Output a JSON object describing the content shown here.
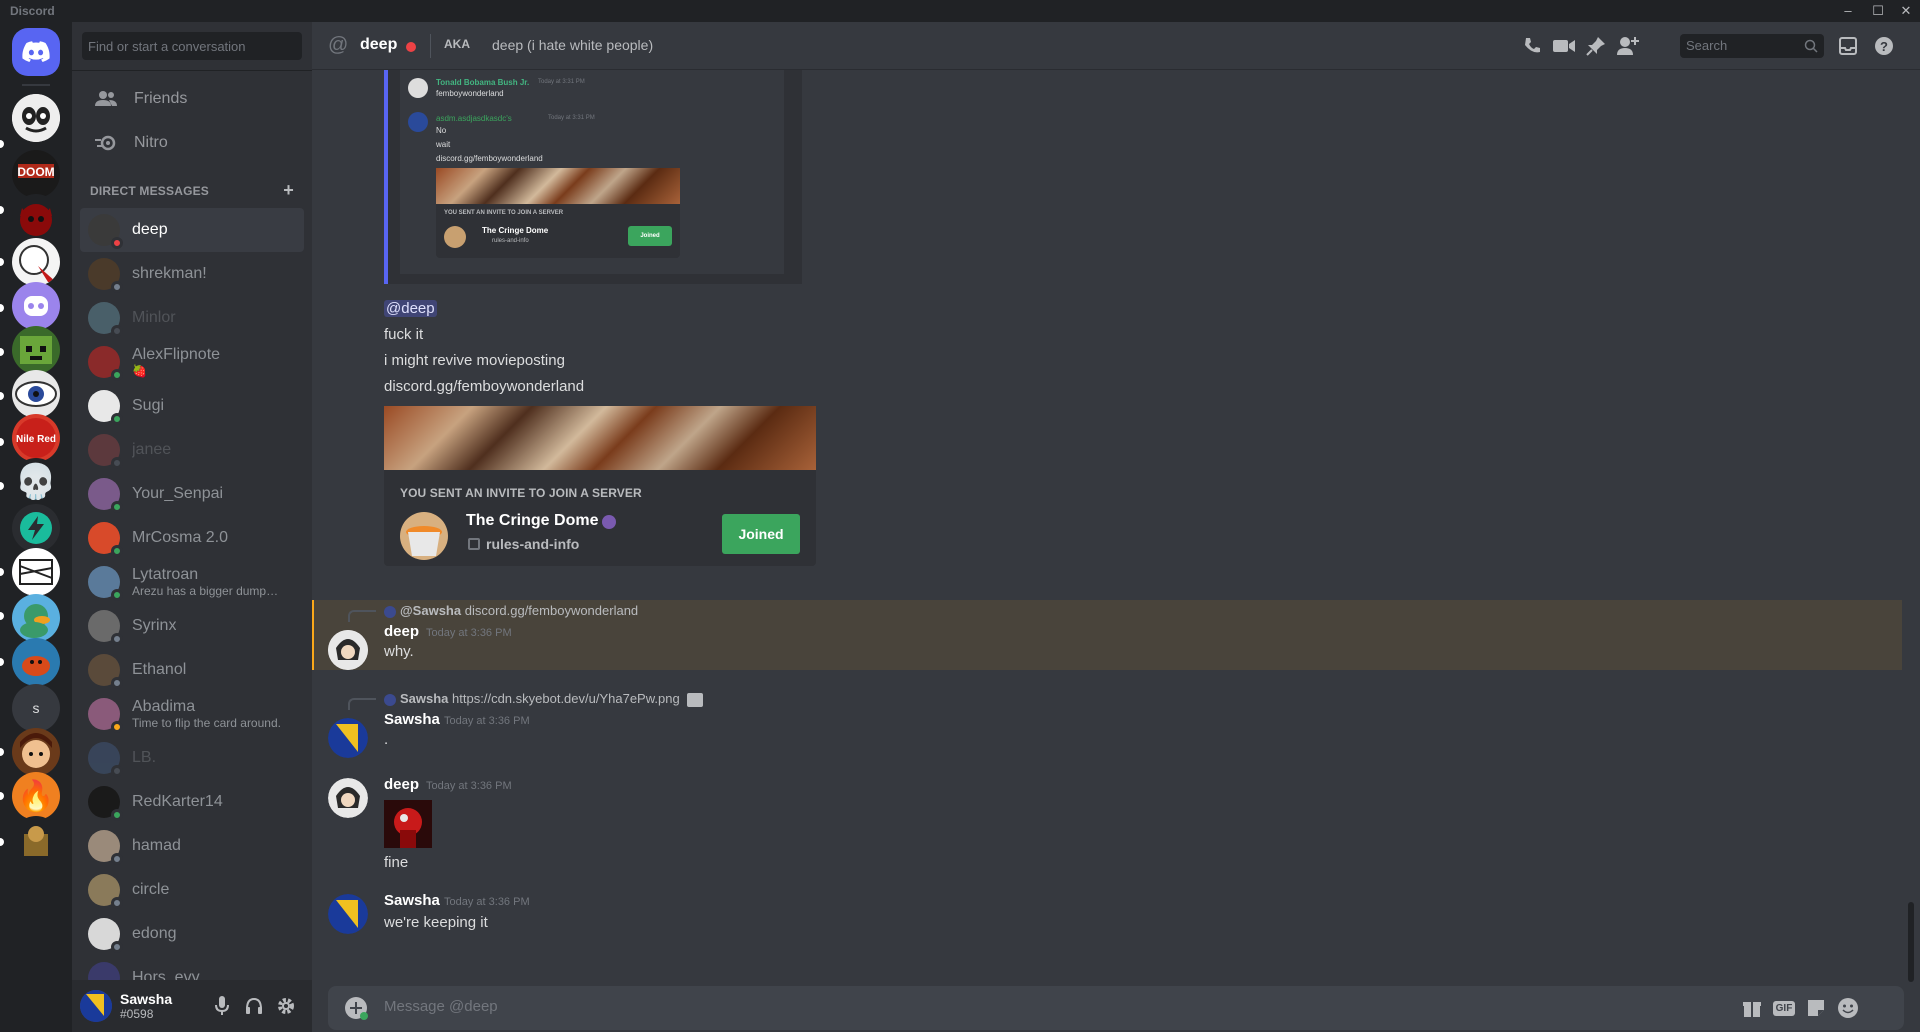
{
  "window": {
    "app_name": "Discord",
    "minimize": "–",
    "maximize": "☐",
    "close": "✕"
  },
  "sidebar": {
    "search_placeholder": "Find or start a conversation",
    "friends_label": "Friends",
    "nitro_label": "Nitro",
    "dm_header": "DIRECT MESSAGES",
    "dm_add": "+",
    "dms": [
      {
        "name": "deep",
        "sub": "",
        "status_color": "#ed4245",
        "avatar_color": "#3a3a3a",
        "active": true,
        "offline": false
      },
      {
        "name": "shrekman!",
        "sub": "",
        "status_color": "#747f8d",
        "avatar_color": "#4a3a2a",
        "active": false,
        "offline": false
      },
      {
        "name": "Minlor",
        "sub": "",
        "status_color": "#747f8d",
        "avatar_color": "#7ab4c9",
        "active": false,
        "offline": true
      },
      {
        "name": "AlexFlipnote",
        "sub": "🍓",
        "status_color": "#3ba55d",
        "avatar_color": "#8a2a2a",
        "active": false,
        "offline": false
      },
      {
        "name": "Sugi",
        "sub": "",
        "status_color": "#3ba55d",
        "avatar_color": "#e8e8e8",
        "active": false,
        "offline": false
      },
      {
        "name": "janee",
        "sub": "",
        "status_color": "#747f8d",
        "avatar_color": "#b04a4a",
        "active": false,
        "offline": true
      },
      {
        "name": "Your_Senpai",
        "sub": "",
        "status_color": "#3ba55d",
        "avatar_color": "#7a5a8a",
        "active": false,
        "offline": false
      },
      {
        "name": "MrCosma 2.0",
        "sub": "",
        "status_color": "#3ba55d",
        "avatar_color": "#d84a2a",
        "active": false,
        "offline": false
      },
      {
        "name": "Lytatroan",
        "sub": "Arezu has a bigger dumpy ...",
        "status_color": "#3ba55d",
        "avatar_color": "#5a7a9a",
        "active": false,
        "offline": false
      },
      {
        "name": "Syrinx",
        "sub": "",
        "status_color": "#747f8d",
        "avatar_color": "#6a6a6a",
        "active": false,
        "offline": false
      },
      {
        "name": "Ethanol",
        "sub": "",
        "status_color": "#747f8d",
        "avatar_color": "#5a4a3a",
        "active": false,
        "offline": false
      },
      {
        "name": "Abadima",
        "sub": "Time to flip the card around.",
        "status_color": "#faa81a",
        "avatar_color": "#8a5a7a",
        "active": false,
        "offline": false
      },
      {
        "name": "LB.",
        "sub": "",
        "status_color": "#747f8d",
        "avatar_color": "#4a6a9a",
        "active": false,
        "offline": true
      },
      {
        "name": "RedKarter14",
        "sub": "",
        "status_color": "#3ba55d",
        "avatar_color": "#1a1a1a",
        "active": false,
        "offline": false
      },
      {
        "name": "hamad",
        "sub": "",
        "status_color": "#747f8d",
        "avatar_color": "#9a8a7a",
        "active": false,
        "offline": false
      },
      {
        "name": "circle",
        "sub": "",
        "status_color": "#747f8d",
        "avatar_color": "#8a7a5a",
        "active": false,
        "offline": false
      },
      {
        "name": "edong",
        "sub": "",
        "status_color": "#747f8d",
        "avatar_color": "#d8d8d8",
        "active": false,
        "offline": false
      },
      {
        "name": "Hors_evy",
        "sub": "",
        "status_color": "#747f8d",
        "avatar_color": "#3a3a6a",
        "active": false,
        "offline": false
      }
    ]
  },
  "user": {
    "name": "Sawsha",
    "tag": "#0598"
  },
  "topbar": {
    "name": "deep",
    "aka_label": "AKA",
    "aka_name": "deep (i hate white people)",
    "search_placeholder": "Search"
  },
  "messages": {
    "mini_embed": {
      "user1": "Tonald Bobama Bush Jr.",
      "time1": "Today at 3:31 PM",
      "text1": "femboywonderland",
      "user2": "asdm.asdjasdkasdc's",
      "time2": "Today at 3:31 PM",
      "line_a": "No",
      "line_b": "wait",
      "line_c": "discord.gg/femboywonderland",
      "inv_head": "YOU SENT AN INVITE TO JOIN A SERVER",
      "server": "The Cringe Dome",
      "channel": "rules-and-info",
      "btn": "Joined"
    },
    "block1": {
      "mention": "@deep",
      "line1": "fuck it",
      "line2": "i might revive movieposting",
      "line3": "discord.gg/femboywonderland",
      "inv_head": "YOU SENT AN INVITE TO JOIN A SERVER",
      "server": "The Cringe Dome",
      "channel": "rules-and-info",
      "btn": "Joined"
    },
    "m1": {
      "reply_user": "@Sawsha",
      "reply_text": "discord.gg/femboywonderland",
      "name": "deep",
      "time": "Today at 3:36 PM",
      "text": "why."
    },
    "m2": {
      "reply_user": "Sawsha",
      "reply_text": "https://cdn.skyebot.dev/u/Yha7ePw.png",
      "name": "Sawsha",
      "time": "Today at 3:36 PM",
      "text": "."
    },
    "m3": {
      "name": "deep",
      "time": "Today at 3:36 PM",
      "text": "fine"
    },
    "m4": {
      "name": "Sawsha",
      "time": "Today at 3:36 PM",
      "text": "we're keeping it"
    }
  },
  "composer": {
    "placeholder": "Message @deep",
    "gif": "GIF"
  },
  "icons": {
    "server_letter": "s",
    "skull": "💀",
    "fire": "🔥",
    "bolt": "⚡",
    "eye": "👁"
  },
  "colors": {
    "brand": "#5865f2",
    "join": "#3ba55d",
    "dnd": "#ed4245",
    "highlight": "#faa81a"
  }
}
